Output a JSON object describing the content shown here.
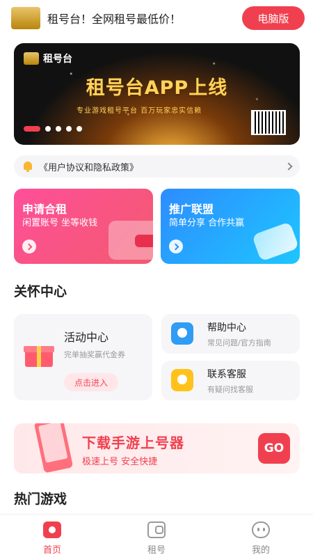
{
  "header": {
    "title": "租号台！全网租号最低价！",
    "pc_button": "电脑版",
    "logo_text": "租号台"
  },
  "banner": {
    "brand": "租号台",
    "title": "租号台APP上线",
    "subtitle": "专业游戏租号平台 百万玩家忠实信赖",
    "slide_count": 5,
    "active_slide": 1
  },
  "notice": {
    "text": "《用户协议和隐私政策》"
  },
  "promo": {
    "rent": {
      "title": "申请合租",
      "subtitle": "闲置账号 坐等收钱"
    },
    "affiliate": {
      "title": "推广联盟",
      "subtitle": "简单分享 合作共赢"
    }
  },
  "care": {
    "section_title": "关怀中心",
    "activity": {
      "title": "活动中心",
      "subtitle": "完单抽奖赢代金券",
      "button": "点击进入"
    },
    "help": {
      "title": "帮助中心",
      "subtitle": "常见问题/官方指南"
    },
    "contact": {
      "title": "联系客服",
      "subtitle": "有疑问找客服"
    }
  },
  "download": {
    "title": "下载手游上号器",
    "subtitle": "极速上号 安全快捷",
    "button": "GO"
  },
  "hot_games": {
    "section_title": "热门游戏"
  },
  "tabbar": {
    "tabs": [
      {
        "label": "首页",
        "icon": "home-icon",
        "active": true
      },
      {
        "label": "租号",
        "icon": "rent-icon",
        "active": false
      },
      {
        "label": "我的",
        "icon": "profile-icon",
        "active": false
      }
    ]
  },
  "colors": {
    "accent": "#f0404f",
    "pink_card": "#ff4f9a",
    "blue_card": "#2d8cff"
  }
}
